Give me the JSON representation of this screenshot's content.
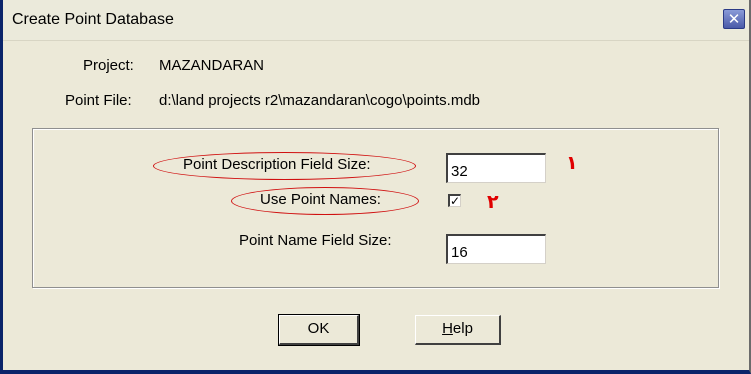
{
  "window": {
    "title": "Create Point Database",
    "close_glyph": "✕"
  },
  "info": {
    "project_label": "Project:",
    "project_value": "MAZANDARAN",
    "point_file_label": "Point File:",
    "point_file_value": "d:\\land projects r2\\mazandaran\\cogo\\points.mdb"
  },
  "fields": {
    "point_description_label": "Point Description Field Size:",
    "point_description_value": "32",
    "use_point_names_label": "Use Point Names:",
    "use_point_names_checked": true,
    "use_point_names_mark": "✓",
    "point_name_size_label": "Point Name Field Size:",
    "point_name_size_value": "16"
  },
  "annotations": {
    "marker_1": "۱",
    "marker_2": "۲",
    "oval_color": "#d01010"
  },
  "buttons": {
    "ok_label": "OK",
    "help_accel": "H",
    "help_rest": "elp"
  }
}
